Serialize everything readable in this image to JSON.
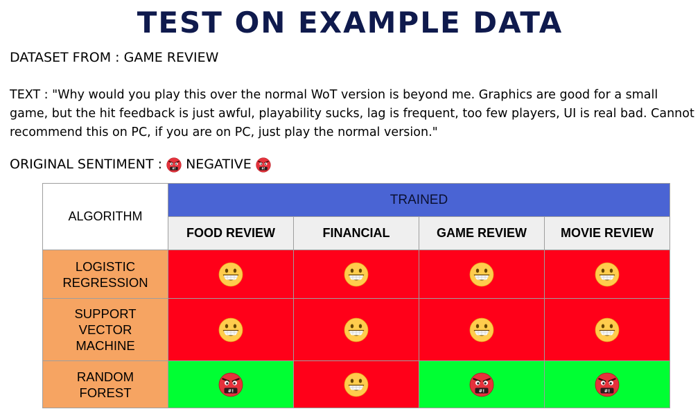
{
  "title": "TEST ON EXAMPLE DATA",
  "dataset_line": "DATASET FROM : GAME REVIEW",
  "text_line": "TEXT : \"Why would you play this over the normal WoT version is beyond me. Graphics are good for a small game, but the hit feedback is just awful, playability sucks, lag is frequent, too few players, UI is real bad. Cannot recommend this on PC, if you are on PC, just play the normal version.\"",
  "sentiment": {
    "label": "ORIGINAL SENTIMENT :",
    "value": "NEGATIVE",
    "icon": "angry-face-icon"
  },
  "table": {
    "algorithm_header": "ALGORITHM",
    "trained_header": "TRAINED",
    "columns": [
      "FOOD REVIEW",
      "FINANCIAL",
      "GAME REVIEW",
      "MOVIE REVIEW"
    ],
    "rows": [
      {
        "algorithm": [
          "LOGISTIC",
          "REGRESSION"
        ],
        "results": [
          "positive",
          "positive",
          "positive",
          "positive"
        ],
        "correct": [
          false,
          false,
          false,
          false
        ]
      },
      {
        "algorithm": [
          "SUPPORT",
          "VECTOR",
          "MACHINE"
        ],
        "results": [
          "positive",
          "positive",
          "positive",
          "positive"
        ],
        "correct": [
          false,
          false,
          false,
          false
        ]
      },
      {
        "algorithm": [
          "RANDOM",
          "FOREST"
        ],
        "results": [
          "negative",
          "positive",
          "negative",
          "negative"
        ],
        "correct": [
          true,
          false,
          true,
          true
        ]
      }
    ]
  },
  "colors": {
    "title": "#0f1a4d",
    "trained_header_bg": "#4a64d4",
    "algorithm_bg": "#f6a462",
    "incorrect_bg": "#ff0019",
    "correct_bg": "#00ff33",
    "column_header_bg": "#efefef"
  },
  "icons": {
    "positive": "grinning-face-icon",
    "negative": "angry-face-icon"
  }
}
